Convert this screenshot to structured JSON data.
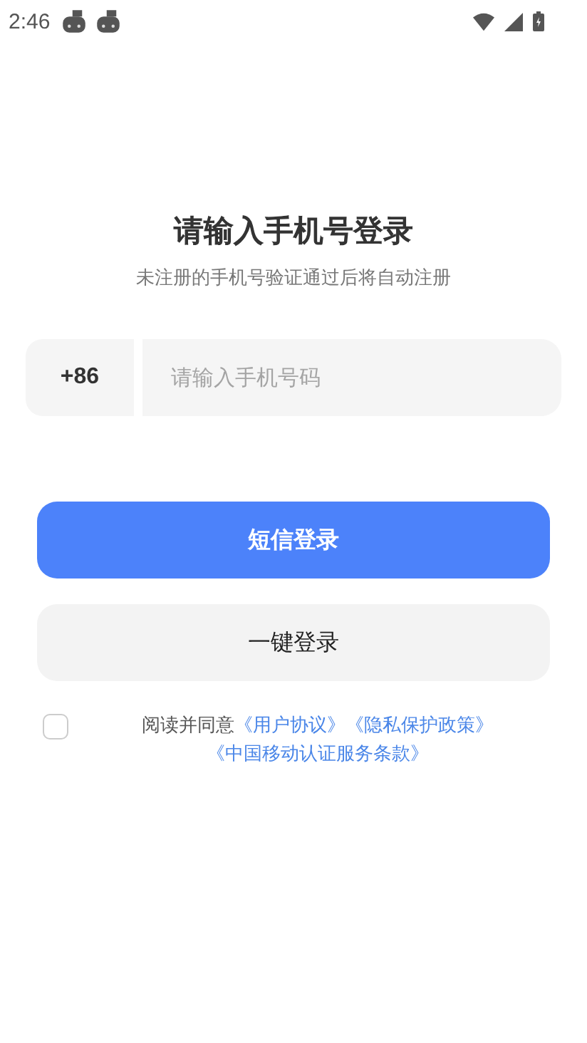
{
  "status_bar": {
    "time": "2:46"
  },
  "title": "请输入手机号登录",
  "subtitle": "未注册的手机号验证通过后将自动注册",
  "phone": {
    "country_code": "+86",
    "placeholder": "请输入手机号码"
  },
  "buttons": [
    {
      "label": "短信登录",
      "kind": "primary"
    },
    {
      "label": "一键登录",
      "kind": "secondary"
    }
  ],
  "agreement": {
    "checked": false,
    "text": "阅读并同意",
    "links": [
      "《用户协议》",
      "《隐私保护政策》",
      "《中国移动认证服务条款》"
    ]
  }
}
